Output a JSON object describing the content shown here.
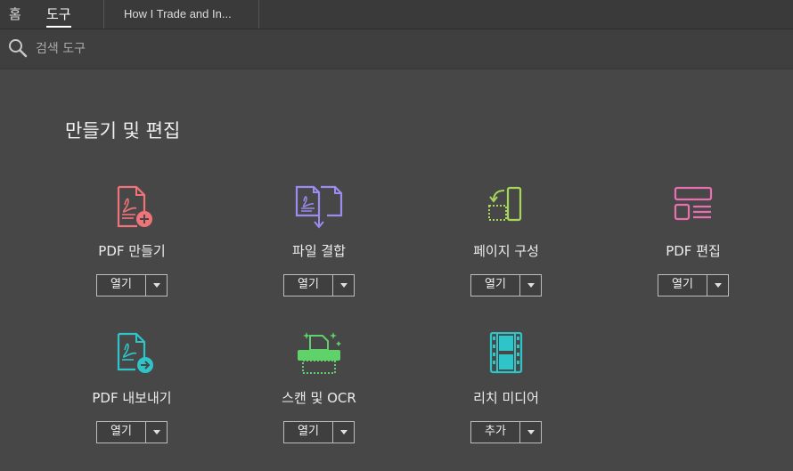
{
  "tabs": {
    "home": "홈",
    "tools": "도구",
    "document": "How I Trade and In..."
  },
  "search": {
    "placeholder": "검색 도구"
  },
  "section": {
    "title": "만들기 및 편집"
  },
  "tools": [
    {
      "label": "PDF 만들기",
      "button": "열기",
      "icon": "create-pdf-icon",
      "color": "#f0737a"
    },
    {
      "label": "파일 결합",
      "button": "열기",
      "icon": "combine-files-icon",
      "color": "#9b8cf2"
    },
    {
      "label": "페이지 구성",
      "button": "열기",
      "icon": "organize-pages-icon",
      "color": "#a8d65a"
    },
    {
      "label": "PDF 편집",
      "button": "열기",
      "icon": "edit-pdf-icon",
      "color": "#e86fb0"
    },
    {
      "label": "PDF 내보내기",
      "button": "열기",
      "icon": "export-pdf-icon",
      "color": "#2ec4c8"
    },
    {
      "label": "스캔 및 OCR",
      "button": "열기",
      "icon": "scan-ocr-icon",
      "color": "#5fd36a"
    },
    {
      "label": "리치 미디어",
      "button": "추가",
      "icon": "rich-media-icon",
      "color": "#2ec4c8"
    }
  ]
}
